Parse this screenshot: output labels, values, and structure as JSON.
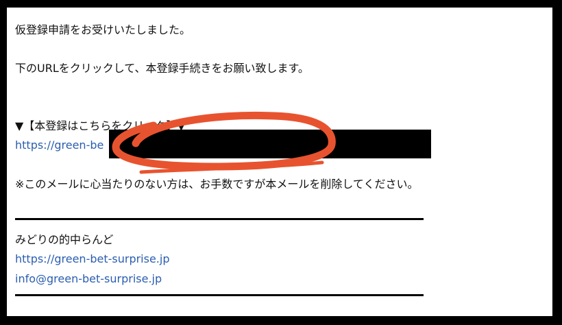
{
  "email": {
    "intro": "仮登録申請をお受けいたしました。",
    "instruction": "下のURLをクリックして、本登録手続きをお願い致します。",
    "link_heading": "▼【本登録はこちらをクリック】▼",
    "link_visible_prefix": "https://green-be",
    "notice": "※このメールに心当たりのない方は、お手数ですが本メールを削除してください。"
  },
  "signature": {
    "name": "みどりの的中らんど",
    "website": "https://green-bet-surprise.jp",
    "email": "info@green-bet-surprise.jp"
  },
  "colors": {
    "link": "#2a5db0",
    "annotation": "#e8532f",
    "redaction": "#000000"
  }
}
